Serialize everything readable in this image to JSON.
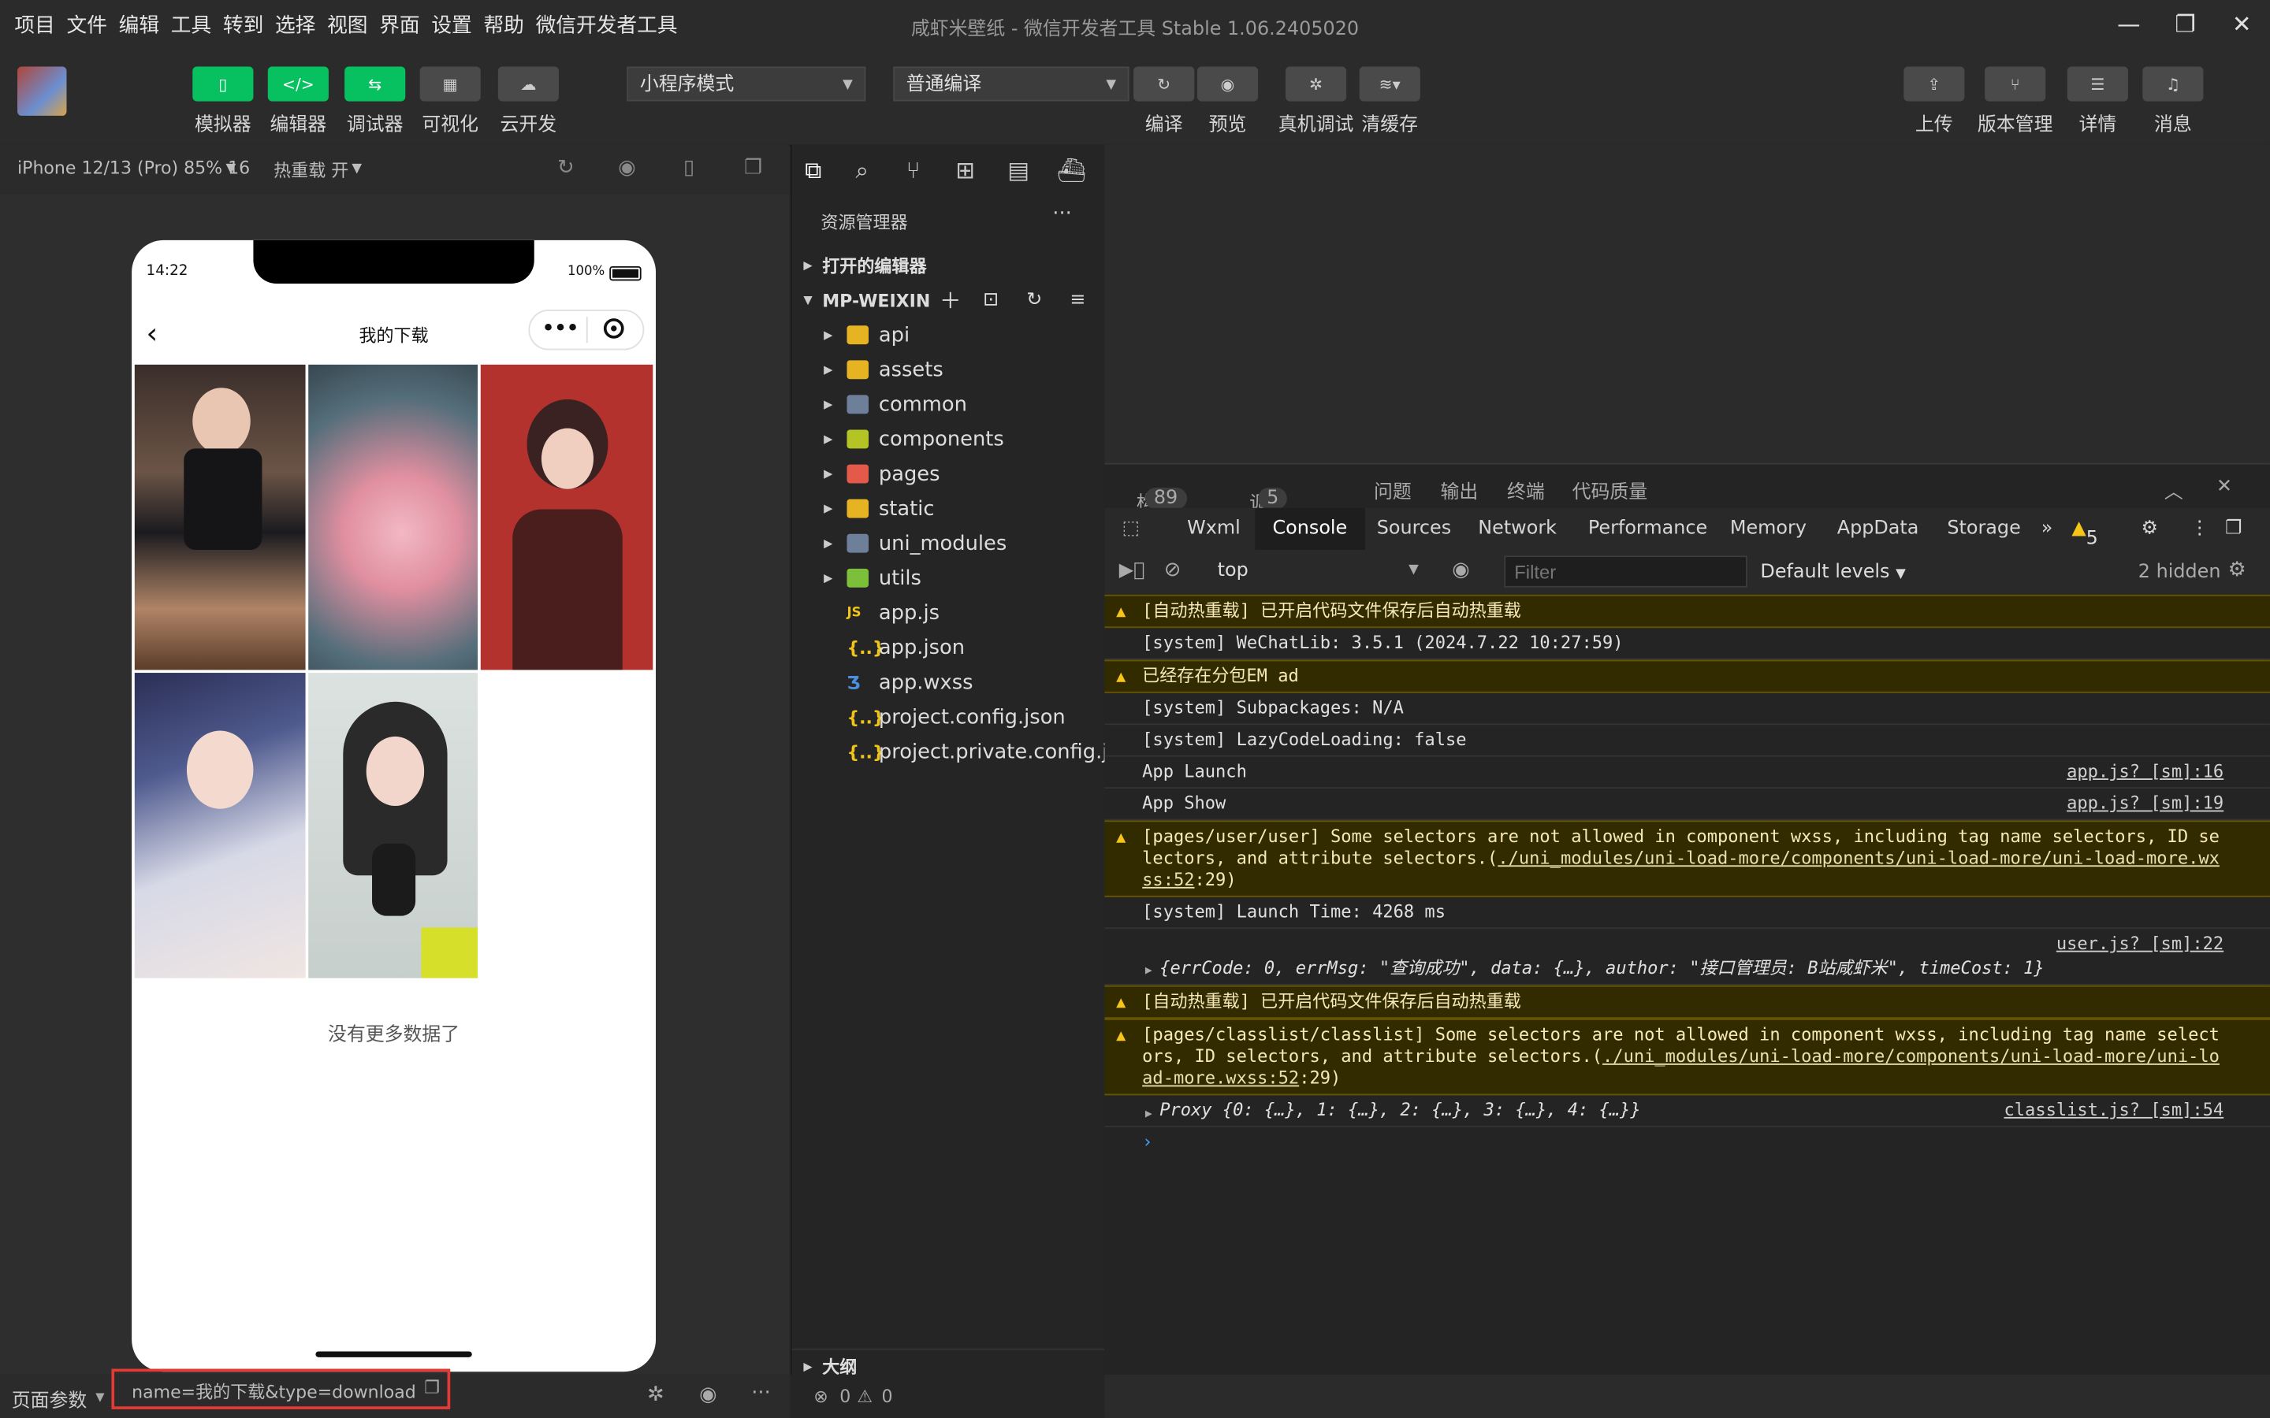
{
  "menubar": {
    "items": [
      "项目",
      "文件",
      "编辑",
      "工具",
      "转到",
      "选择",
      "视图",
      "界面",
      "设置",
      "帮助",
      "微信开发者工具"
    ],
    "title": "咸虾米壁纸 - 微信开发者工具 Stable 1.06.2405020"
  },
  "toolbar": {
    "left_buttons": [
      "模拟器",
      "编辑器",
      "调试器",
      "可视化",
      "云开发"
    ],
    "mode_select": "小程序模式",
    "compile_select": "普通编译",
    "mid_buttons": [
      "编译",
      "预览",
      "真机调试",
      "清缓存"
    ],
    "right_buttons": [
      "上传",
      "版本管理",
      "详情",
      "消息"
    ]
  },
  "simbar": {
    "device": "iPhone 12/13 (Pro) 85% 16",
    "hotreload": "热重载 开"
  },
  "phone": {
    "time": "14:22",
    "battery": "100%",
    "nav_title": "我的下载",
    "no_more": "没有更多数据了"
  },
  "explorer": {
    "title": "资源管理器",
    "open_editors": "打开的编辑器",
    "project": "MP-WEIXIN",
    "folders": [
      "api",
      "assets",
      "common",
      "components",
      "pages",
      "static",
      "uni_modules",
      "utils"
    ],
    "files": [
      "app.js",
      "app.json",
      "app.wxss",
      "project.config.json",
      "project.private.config.js..."
    ],
    "outline": "大纲",
    "errors": "0",
    "warnings": "0"
  },
  "panel": {
    "tabs": [
      {
        "label": "构建",
        "badge": "89"
      },
      {
        "label": "调试器",
        "badge": "5"
      },
      {
        "label": "问题",
        "badge": ""
      },
      {
        "label": "输出",
        "badge": ""
      },
      {
        "label": "终端",
        "badge": ""
      },
      {
        "label": "代码质量",
        "badge": ""
      }
    ],
    "devtools_tabs": [
      "Wxml",
      "Console",
      "Sources",
      "Network",
      "Performance",
      "Memory",
      "AppData",
      "Storage"
    ],
    "warn_count": "5",
    "context": "top",
    "filter_placeholder": "Filter",
    "levels": "Default levels",
    "hidden": "2 hidden"
  },
  "console": [
    {
      "type": "warn",
      "text": "[自动热重载] 已开启代码文件保存后自动热重载"
    },
    {
      "type": "log",
      "text": "[system] WeChatLib: 3.5.1 (2024.7.22 10:27:59)"
    },
    {
      "type": "warn",
      "text": "已经存在分包EM ad"
    },
    {
      "type": "log",
      "text": "[system] Subpackages: N/A"
    },
    {
      "type": "log",
      "text": "[system] LazyCodeLoading: false"
    },
    {
      "type": "log",
      "text": "App Launch",
      "src": "app.js? [sm]:16"
    },
    {
      "type": "log",
      "text": "App Show",
      "src": "app.js? [sm]:19"
    },
    {
      "type": "warn",
      "text": "[pages/user/user] Some selectors are not allowed in component wxss, including tag name selectors, ID selectors, and attribute selectors.(",
      "link": "./uni_modules/uni-load-more/components/uni-load-more/uni-load-more.wxss:52",
      "tail": ":29)"
    },
    {
      "type": "log",
      "text": "[system] Launch Time: 4268 ms"
    },
    {
      "type": "obj",
      "src": "user.js? [sm]:22",
      "text": "{errCode: 0, errMsg: \"查询成功\", data: {…}, author: \"接口管理员: B站咸虾米\", timeCost: 1}"
    },
    {
      "type": "warn",
      "text": "[自动热重载] 已开启代码文件保存后自动热重载"
    },
    {
      "type": "warn",
      "text": "[pages/classlist/classlist] Some selectors are not allowed in component wxss, including tag name selectors, ID selectors, and attribute selectors.(",
      "link": "./uni_modules/uni-load-more/components/uni-load-more/uni-load-more.wxss:52",
      "tail": ":29)"
    },
    {
      "type": "proxy",
      "text": "Proxy {0: {…}, 1: {…}, 2: {…}, 3: {…}, 4: {…}}",
      "src": "classlist.js? [sm]:54"
    }
  ],
  "statusbar": {
    "page_params": "页面参数",
    "params_value": "name=我的下载&type=download"
  },
  "colors": {
    "accent": "#07c160",
    "warn_bg": "#332b00",
    "highlight_box": "#e53935"
  }
}
